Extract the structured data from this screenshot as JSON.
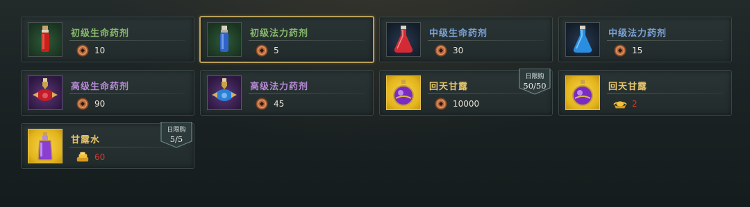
{
  "shop": {
    "items": [
      {
        "name": "初级生命药剂",
        "price": "10",
        "currency_icon": "copper-coin-icon",
        "price_color": "#e8e3d6",
        "tier": "green",
        "potion": "small-red",
        "selected": false,
        "limit": null
      },
      {
        "name": "初级法力药剂",
        "price": "5",
        "currency_icon": "copper-coin-icon",
        "price_color": "#e8e3d6",
        "tier": "green",
        "potion": "small-blue",
        "selected": true,
        "limit": null
      },
      {
        "name": "中级生命药剂",
        "price": "30",
        "currency_icon": "copper-coin-icon",
        "price_color": "#e8e3d6",
        "tier": "blue",
        "potion": "medium-red",
        "selected": false,
        "limit": null
      },
      {
        "name": "中级法力药剂",
        "price": "15",
        "currency_icon": "copper-coin-icon",
        "price_color": "#e8e3d6",
        "tier": "blue",
        "potion": "medium-blue",
        "selected": false,
        "limit": null
      },
      {
        "name": "高级生命药剂",
        "price": "90",
        "currency_icon": "copper-coin-icon",
        "price_color": "#e8e3d6",
        "tier": "purple",
        "potion": "large-red",
        "selected": false,
        "limit": null
      },
      {
        "name": "高级法力药剂",
        "price": "45",
        "currency_icon": "copper-coin-icon",
        "price_color": "#e8e3d6",
        "tier": "purple",
        "potion": "large-blue",
        "selected": false,
        "limit": null
      },
      {
        "name": "回天甘露",
        "price": "10000",
        "currency_icon": "copper-coin-icon",
        "price_color": "#e8e3d6",
        "tier": "gold",
        "potion": "purple-orb",
        "selected": false,
        "limit": {
          "label": "日限购",
          "count": "50/50"
        }
      },
      {
        "name": "回天甘露",
        "price": "2",
        "currency_icon": "gold-ingot-icon",
        "price_color": "#d23b2c",
        "tier": "gold",
        "potion": "purple-orb",
        "selected": false,
        "limit": null
      },
      {
        "name": "甘露水",
        "price": "60",
        "currency_icon": "gold-ingot-stack-icon",
        "price_color": "#d23b2c",
        "tier": "gold",
        "potion": "purple-flask",
        "selected": false,
        "limit": {
          "label": "日限购",
          "count": "5/5"
        }
      }
    ]
  },
  "colors": {
    "panel_border": "#3b4646",
    "selected_border": "#b8a05a",
    "green_name": "#86b86c",
    "blue_name": "#7aa0d4",
    "purple_name": "#b58ad6",
    "gold_name": "#e6c46a",
    "price_red": "#d23b2c"
  }
}
